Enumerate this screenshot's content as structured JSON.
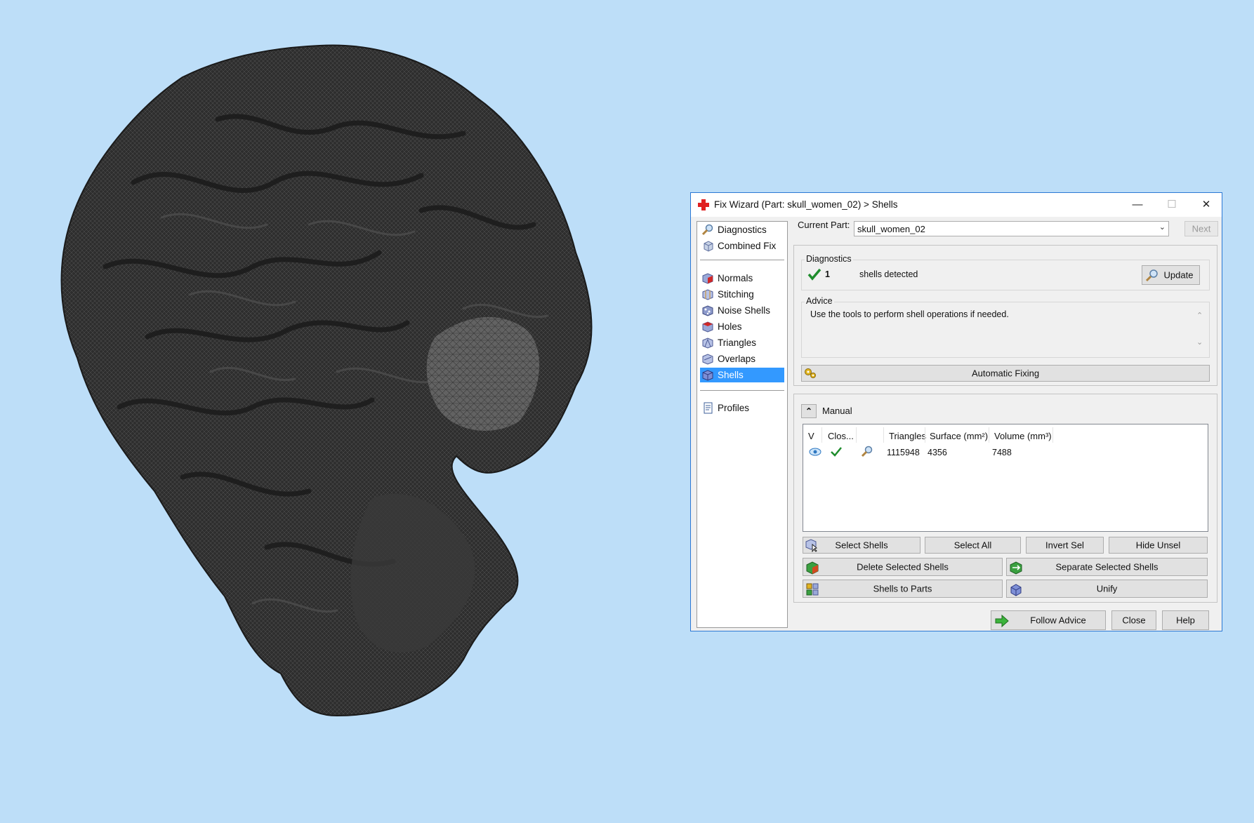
{
  "window": {
    "title": "Fix Wizard (Part: skull_women_02) > Shells",
    "minimize": "—",
    "maximize": "☐",
    "close": "✕"
  },
  "sidebar": {
    "items": [
      {
        "label": "Diagnostics",
        "icon": "diagnostics-magnifier-icon"
      },
      {
        "label": "Combined Fix",
        "icon": "combined-fix-icon"
      },
      {
        "label": "Normals",
        "icon": "normals-cube-icon"
      },
      {
        "label": "Stitching",
        "icon": "stitching-cube-icon"
      },
      {
        "label": "Noise Shells",
        "icon": "noise-shells-icon"
      },
      {
        "label": "Holes",
        "icon": "holes-cube-icon"
      },
      {
        "label": "Triangles",
        "icon": "triangles-icon"
      },
      {
        "label": "Overlaps",
        "icon": "overlaps-icon"
      },
      {
        "label": "Shells",
        "icon": "shells-cube-icon",
        "selected": true
      },
      {
        "label": "Profiles",
        "icon": "profiles-document-icon"
      }
    ]
  },
  "current_part": {
    "label": "Current Part:",
    "value": "skull_women_02",
    "next_label": "Next"
  },
  "diagnostics": {
    "group_label": "Diagnostics",
    "count": "1",
    "status_text": "shells detected",
    "update_label": "Update"
  },
  "advice": {
    "group_label": "Advice",
    "text": "Use the tools to perform shell operations if needed.",
    "auto_fix_label": "Automatic Fixing"
  },
  "manual": {
    "label": "Manual",
    "columns": [
      "V",
      "Clos...",
      "",
      "Triangles",
      "Surface (mm²)",
      "Volume (mm³)"
    ],
    "rows": [
      {
        "visible_icon": "eye-icon",
        "closed_icon": "checkmark-icon",
        "action_icon": "magnifier-icon",
        "triangles": "1115948",
        "surface": "4356",
        "volume": "7488"
      }
    ],
    "buttons": {
      "select_shells": "Select Shells",
      "select_all": "Select All",
      "invert_sel": "Invert Sel",
      "hide_unsel": "Hide Unsel",
      "delete_selected": "Delete Selected Shells",
      "separate_selected": "Separate Selected Shells",
      "shells_to_parts": "Shells to Parts",
      "unify": "Unify"
    }
  },
  "footer": {
    "follow_advice": "Follow Advice",
    "close": "Close",
    "help": "Help"
  },
  "colors": {
    "background": "#bddef8",
    "selection": "#3399ff",
    "window_border": "#2b78d4",
    "model": "#2c2c2c"
  }
}
